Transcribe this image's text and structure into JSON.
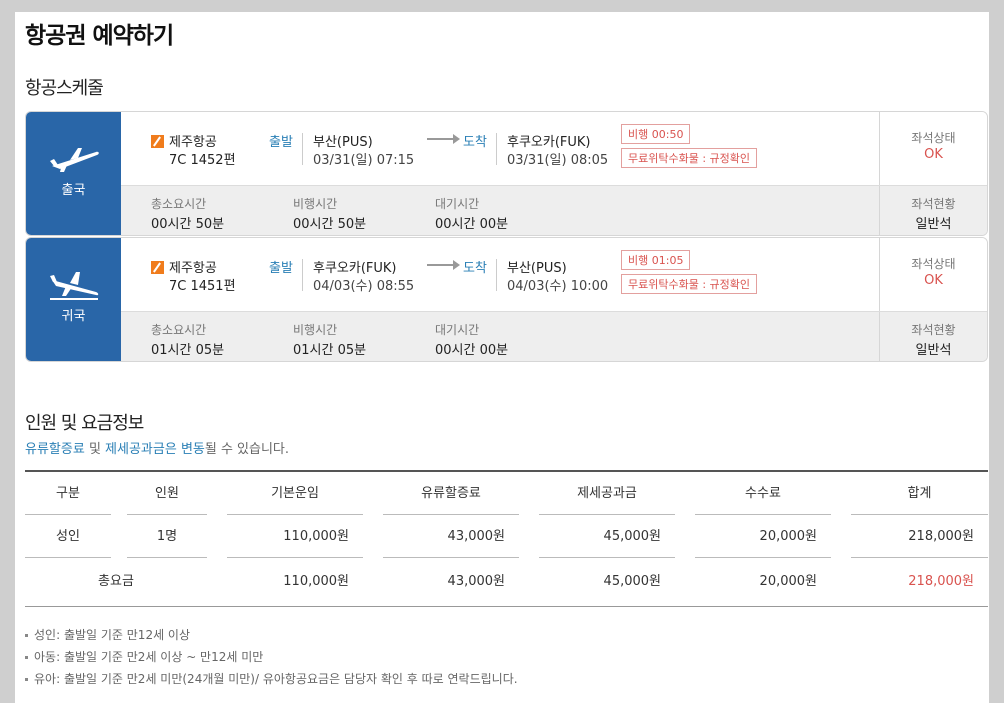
{
  "page_title": "항공권 예약하기",
  "schedule": {
    "title": "항공스케줄",
    "legs": [
      {
        "badge": "출국",
        "airline": "제주항공",
        "flight_no": "7C 1452편",
        "dep_label": "출발",
        "dep_city": "부산(PUS)",
        "dep_time": "03/31(일) 07:15",
        "arr_label": "도착",
        "arr_city": "후쿠오카(FUK)",
        "arr_time": "03/31(일) 08:05",
        "flight_tag": "비행 00:50",
        "baggage_tag": "무료위탁수화물 : 규정확인",
        "seat_status_label": "좌석상태",
        "seat_status": "OK",
        "total_label": "총소요시간",
        "total_value": "00시간 50분",
        "flight_label": "비행시간",
        "flight_value": "00시간 50분",
        "wait_label": "대기시간",
        "wait_value": "00시간 00분",
        "seat_class_label": "좌석현황",
        "seat_class": "일반석"
      },
      {
        "badge": "귀국",
        "airline": "제주항공",
        "flight_no": "7C 1451편",
        "dep_label": "출발",
        "dep_city": "후쿠오카(FUK)",
        "dep_time": "04/03(수) 08:55",
        "arr_label": "도착",
        "arr_city": "부산(PUS)",
        "arr_time": "04/03(수) 10:00",
        "flight_tag": "비행 01:05",
        "baggage_tag": "무료위탁수화물 : 규정확인",
        "seat_status_label": "좌석상태",
        "seat_status": "OK",
        "total_label": "총소요시간",
        "total_value": "01시간 05분",
        "flight_label": "비행시간",
        "flight_value": "01시간 05분",
        "wait_label": "대기시간",
        "wait_value": "00시간 00분",
        "seat_class_label": "좌석현황",
        "seat_class": "일반석"
      }
    ]
  },
  "fare": {
    "title": "인원 및 요금정보",
    "notice_hl1": "유류할증료",
    "notice_mid": " 및 ",
    "notice_hl2": "제세공과금은 변동",
    "notice_tail": "될 수 있습니다.",
    "headers": [
      "구분",
      "인원",
      "기본운임",
      "유류할증료",
      "제세공과금",
      "수수료",
      "합계"
    ],
    "rows": [
      [
        "성인",
        "1명",
        "110,000원",
        "43,000원",
        "45,000원",
        "20,000원",
        "218,000원"
      ]
    ],
    "total": {
      "label": "총요금",
      "base": "110,000원",
      "fuel": "43,000원",
      "tax": "45,000원",
      "fee": "20,000원",
      "sum": "218,000원"
    }
  },
  "notes": [
    "성인: 출발일 기준 만12세 이상",
    "아동: 출발일 기준 만2세 이상 ~ 만12세 미만",
    "유아: 출발일 기준 만2세 미만(24개월 미만)/ 유아항공요금은 담당자 확인 후 따로 연락드립니다."
  ],
  "colors": {
    "badge": "#2966a8",
    "accent_blue": "#2a7fb5",
    "accent_red": "#d9534f",
    "airline_icon": "#f07c1c"
  }
}
